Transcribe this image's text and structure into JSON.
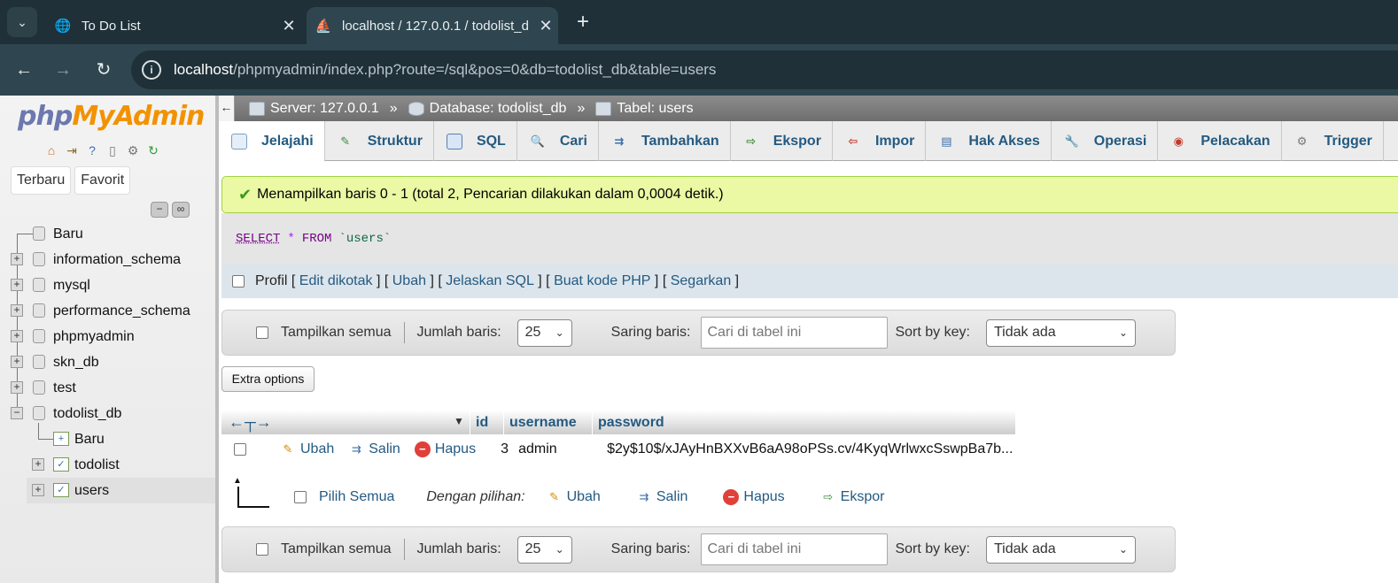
{
  "browser": {
    "tabs": [
      {
        "title": "To Do List",
        "icon": "globe-icon"
      },
      {
        "title": "localhost / 127.0.0.1 / todolist_d",
        "icon": "phpmyadmin-icon"
      }
    ],
    "url_host": "localhost",
    "url_path": "/phpmyadmin/index.php?route=/sql&pos=0&db=todolist_db&table=users"
  },
  "sidebar": {
    "logo_php": "php",
    "logo_ma": "MyAdmin",
    "buttons": [
      "Terbaru",
      "Favorit"
    ],
    "tree": [
      {
        "label": "Baru",
        "kind": "new"
      },
      {
        "label": "information_schema",
        "kind": "db"
      },
      {
        "label": "mysql",
        "kind": "db"
      },
      {
        "label": "performance_schema",
        "kind": "db"
      },
      {
        "label": "phpmyadmin",
        "kind": "db"
      },
      {
        "label": "skn_db",
        "kind": "db"
      },
      {
        "label": "test",
        "kind": "db"
      },
      {
        "label": "todolist_db",
        "kind": "db-open"
      },
      {
        "label": "Baru",
        "kind": "table-new"
      },
      {
        "label": "todolist",
        "kind": "table"
      },
      {
        "label": "users",
        "kind": "table-selected"
      }
    ]
  },
  "breadcrumb": {
    "server": "Server: 127.0.0.1",
    "database": "Database: todolist_db",
    "table": "Tabel: users",
    "sep": "»"
  },
  "tabs": [
    "Jelajahi",
    "Struktur",
    "SQL",
    "Cari",
    "Tambahkan",
    "Ekspor",
    "Impor",
    "Hak Akses",
    "Operasi",
    "Pelacakan",
    "Trigger"
  ],
  "success_message": "Menampilkan baris 0 - 1 (total 2, Pencarian dilakukan dalam 0,0004 detik.)",
  "sql": {
    "select": "SELECT",
    "star": "*",
    "from": "FROM",
    "table": "`users`"
  },
  "profil": {
    "label": "Profil",
    "links": [
      "Edit dikotak",
      "Ubah",
      "Jelaskan SQL",
      "Buat kode PHP",
      "Segarkan"
    ]
  },
  "navigation": {
    "show_all": "Tampilkan semua",
    "rows_label": "Jumlah baris:",
    "rows_value": "25",
    "filter_label": "Saring baris:",
    "filter_placeholder": "Cari di tabel ini",
    "sort_label": "Sort by key:",
    "sort_value": "Tidak ada"
  },
  "extra_options": "Extra options",
  "table": {
    "columns": [
      "id",
      "username",
      "password"
    ],
    "rows": [
      {
        "id": "3",
        "username": "admin",
        "password": "$2y$10$/xJAyHnBXXvB6aA98oPSs.cv/4KyqWrlwxcSswpBa7b..."
      }
    ],
    "actions": [
      "Ubah",
      "Salin",
      "Hapus"
    ]
  },
  "bulk": {
    "select_all": "Pilih Semua",
    "with_selected": "Dengan pilihan:",
    "actions": [
      "Ubah",
      "Salin",
      "Hapus",
      "Ekspor"
    ]
  }
}
